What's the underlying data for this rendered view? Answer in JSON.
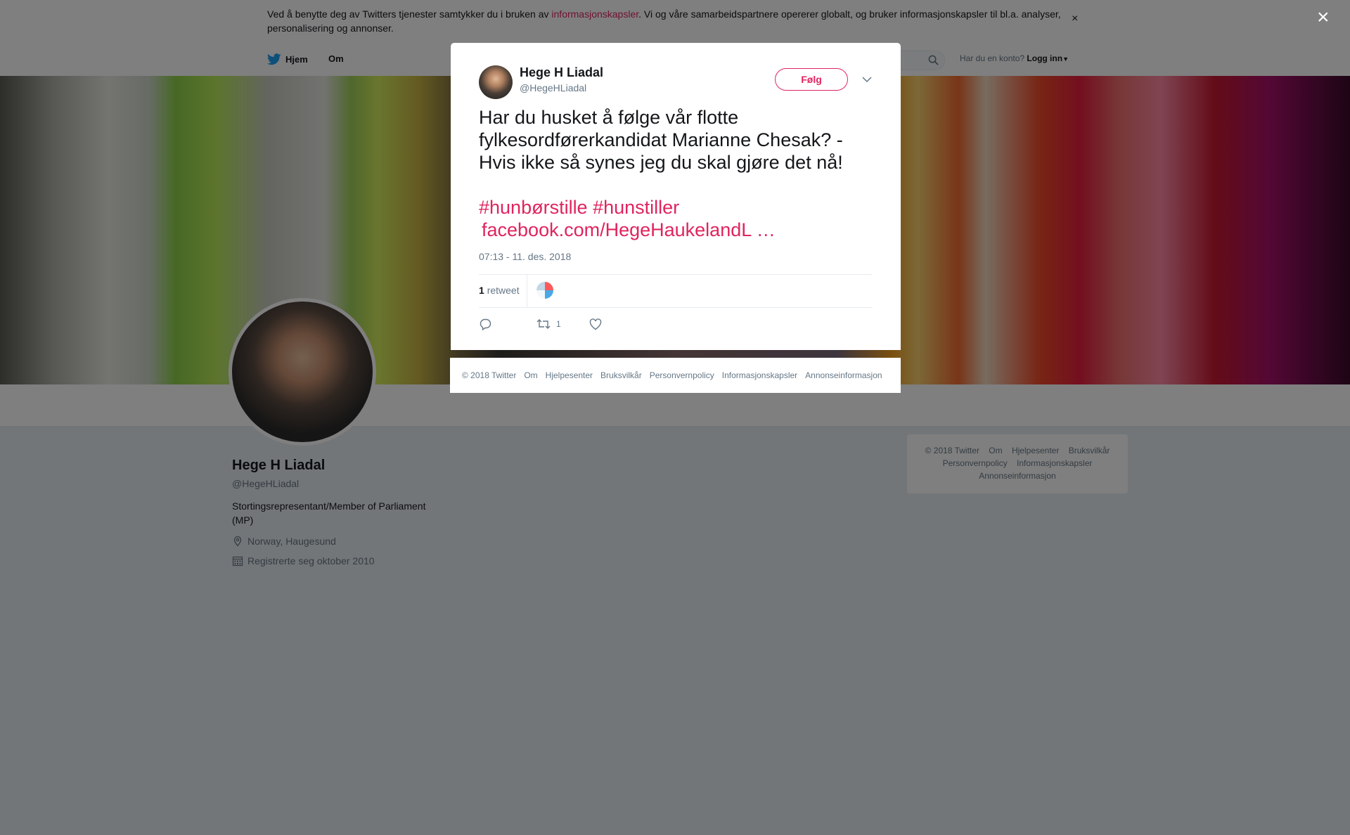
{
  "cookie_banner": {
    "text_before": "Ved å benytte deg av Twitters tjenester samtykker du i bruken av ",
    "link": "informasjonskapsler",
    "text_after": ". Vi og våre samarbeidspartnere opererer globalt, og bruker informasjonskapsler til bl.a. analyser, personalisering og annonser.",
    "close": "×"
  },
  "nav": {
    "home": "Hjem",
    "about": "Om",
    "have_account": "Har du en konto?",
    "login": "Logg inn"
  },
  "profile": {
    "name": "Hege H Liadal",
    "handle": "@HegeHLiadal",
    "bio": "Stortingsrepresentant/Member of Parliament (MP)",
    "location": "Norway, Haugesund",
    "joined": "Registrerte seg oktober 2010"
  },
  "side_footer": {
    "row1": [
      "© 2018 Twitter",
      "Om",
      "Hjelpesenter",
      "Bruksvilkår"
    ],
    "row2": [
      "Personvernpolicy",
      "Informasjonskapsler"
    ],
    "row3": [
      "Annonseinformasjon"
    ]
  },
  "overlay": {
    "close": "×"
  },
  "tweet": {
    "author_name": "Hege H Liadal",
    "author_handle": "@HegeHLiadal",
    "follow_label": "Følg",
    "text": "Har du husket å følge vår flotte fylkesordførerkandidat Marianne Chesak? - Hvis ikke så synes jeg du skal gjøre det nå!",
    "hashtag1": "#hunbørstille",
    "hashtag2": "#hunstiller",
    "link": "facebook.com/HegeHaukelandL …",
    "timestamp": "07:13 - 11. des. 2018",
    "retweet_count": "1",
    "retweet_label": "retweet",
    "action_retweet_count": "1"
  },
  "modal_footer": [
    "© 2018 Twitter",
    "Om",
    "Hjelpesenter",
    "Bruksvilkår",
    "Personvernpolicy",
    "Informasjonskapsler",
    "Annonseinformasjon"
  ],
  "colors": {
    "accent": "#e0245e",
    "twitter_blue": "#1da1f2",
    "muted": "#657786"
  }
}
